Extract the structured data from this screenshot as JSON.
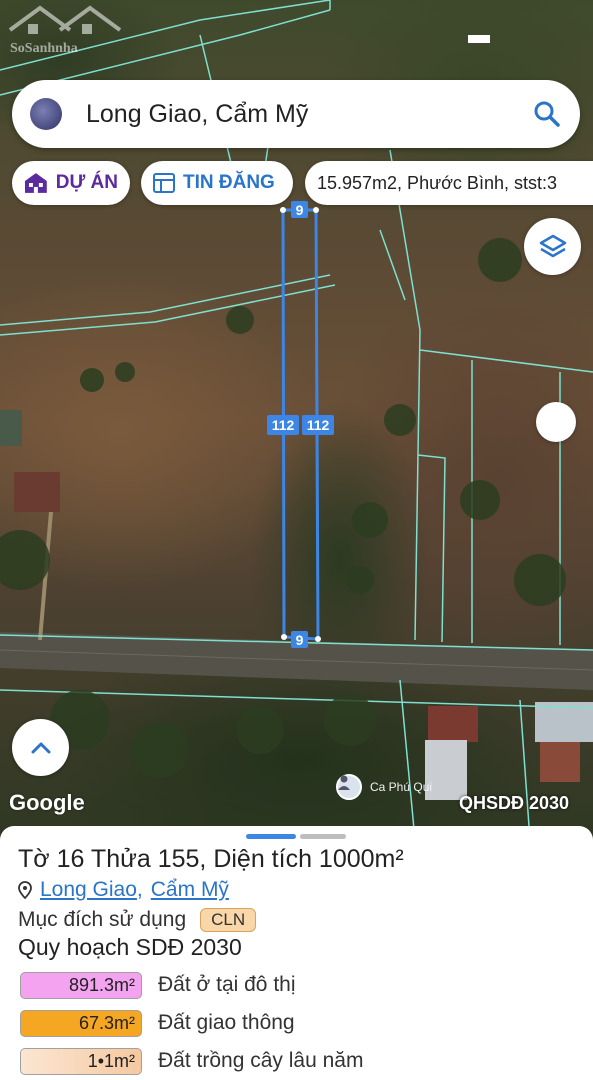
{
  "search": {
    "value": "Long Giao, Cẩm Mỹ"
  },
  "chips": {
    "du_an": "DỰ ÁN",
    "tin_dang": "TIN ĐĂNG",
    "info": "15.957m2, Phước Bình, stst:3"
  },
  "map": {
    "measure_top": "9",
    "measure_bottom": "9",
    "measure_left": "112",
    "measure_right": "112",
    "google_logo": "Google",
    "contributor": "Ca Phú Qui",
    "overlay_label": "QHSDĐ 2030",
    "watermark_text": "SoSanhnha"
  },
  "parcel": {
    "title_sheet": "Tờ ",
    "sheet_no": "16",
    "title_parcel": " Thửa ",
    "parcel_no": "155",
    "title_area": ", Diện tích ",
    "area": "1000m²",
    "ward": "Long Giao",
    "separator": ",",
    "district": "Cẩm Mỹ",
    "purpose_label": "Mục đích sử dụng",
    "purpose_code": "CLN",
    "plan_title": "Quy hoạch SDĐ 2030"
  },
  "zoning": [
    {
      "area": "891.3m²",
      "label": "Đất ở tại đô thị",
      "color": "#f3a3f0"
    },
    {
      "area": "67.3m²",
      "label": "Đất giao thông",
      "color": "#f5a623"
    },
    {
      "area": "1•1m²",
      "label": "Đất trồng cây lâu năm",
      "color": "#f9d7b5"
    }
  ],
  "colors": {
    "accent": "#3d86e6",
    "du_an": "#5a2a9e",
    "tin_dang": "#2a75c9",
    "parcel_lines": "#7fe0d0"
  },
  "icons": {
    "search": "search-icon",
    "du_an": "building-icon",
    "tin_dang": "listing-icon",
    "layers": "layers-icon",
    "expand": "chevron-up-icon",
    "location": "location-pin-icon"
  }
}
